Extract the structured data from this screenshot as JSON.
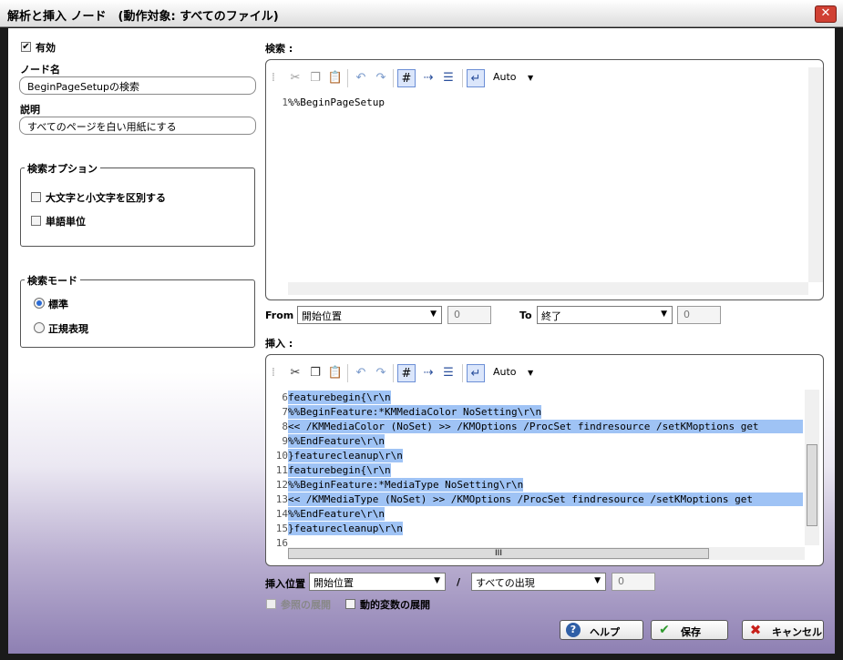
{
  "window": {
    "title": "解析と挿入 ノード　(動作対象: すべてのファイル)",
    "close_label": "✕"
  },
  "left": {
    "enabled_label": "有効",
    "enabled_checked": true,
    "node_name_label": "ノード名",
    "node_name_value": "BeginPageSetupの検索",
    "description_label": "説明",
    "description_value": "すべてのページを白い用紙にする",
    "search_options": {
      "legend": "検索オプション",
      "case_label": "大文字と小文字を区別する",
      "word_label": "単語単位"
    },
    "search_mode": {
      "legend": "検索モード",
      "standard_label": "標準",
      "regex_label": "正規表現",
      "selected": "standard"
    }
  },
  "search": {
    "label": "検索 :",
    "toolbar": {
      "auto_label": "Auto"
    },
    "lines": [
      {
        "num": "1",
        "text": "%%BeginPageSetup"
      }
    ]
  },
  "range": {
    "from_label": "From",
    "from_value": "開始位置",
    "from_num": "0",
    "to_label": "To",
    "to_value": "終了",
    "to_num": "0"
  },
  "insert": {
    "label": "挿入 :",
    "toolbar": {
      "auto_label": "Auto"
    },
    "lines": [
      {
        "num": "6",
        "text": "featurebegin{\\r\\n"
      },
      {
        "num": "7",
        "text": "%%BeginFeature:*KMMediaColor NoSetting\\r\\n"
      },
      {
        "num": "8",
        "text": "<< /KMMediaColor (NoSet) >> /KMOptions /ProcSet findresource /setKMoptions get"
      },
      {
        "num": "9",
        "text": "%%EndFeature\\r\\n"
      },
      {
        "num": "10",
        "text": "}featurecleanup\\r\\n"
      },
      {
        "num": "11",
        "text": "featurebegin{\\r\\n"
      },
      {
        "num": "12",
        "text": "%%BeginFeature:*MediaType NoSetting\\r\\n"
      },
      {
        "num": "13",
        "text": "<< /KMMediaType (NoSet) >> /KMOptions /ProcSet findresource /setKMoptions get"
      },
      {
        "num": "14",
        "text": "%%EndFeature\\r\\n"
      },
      {
        "num": "15",
        "text": "}featurecleanup\\r\\n"
      },
      {
        "num": "16",
        "text": ""
      }
    ],
    "hscroll_thumb_label": "III"
  },
  "insert_pos": {
    "label": "挿入位置",
    "position_value": "開始位置",
    "slash": "/",
    "occurrence_value": "すべての出現",
    "count_value": "0"
  },
  "expand": {
    "ref_label": "参照の展開",
    "dynamic_label": "動的変数の展開"
  },
  "buttons": {
    "help_label": "ヘルプ",
    "save_label": "保存",
    "cancel_label": "キャンセル"
  },
  "colors": {
    "selection": "#9fc3f5",
    "accent": "#2a6bd6",
    "close": "#d04033"
  }
}
